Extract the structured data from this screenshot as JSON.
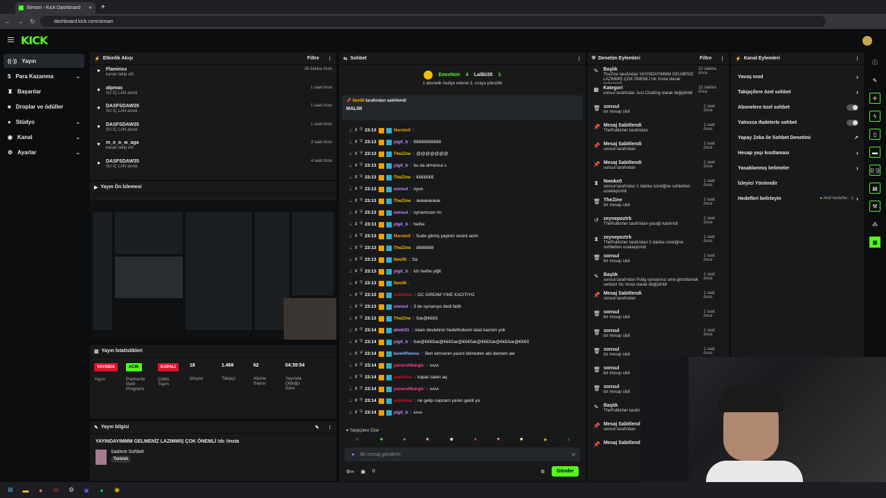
{
  "browser": {
    "tab_title": "Stream - Kick Dashboard",
    "url": "dashboard.kick.com/stream",
    "add_tab": "+",
    "close": "✕"
  },
  "app": {
    "logo": "KICK"
  },
  "sidebar": {
    "items": [
      {
        "label": "Yayın",
        "icon": "stream-icon",
        "active": true
      },
      {
        "label": "Para Kazanma",
        "icon": "money-icon",
        "chevron": true
      },
      {
        "label": "Başarılar",
        "icon": "trophy-icon"
      },
      {
        "label": "Droplar ve ödüller",
        "icon": "gift-icon"
      },
      {
        "label": "Stüdyo",
        "icon": "studio-icon",
        "chevron": true
      },
      {
        "label": "Kanal",
        "icon": "user-icon",
        "chevron": true
      },
      {
        "label": "Ayarlar",
        "icon": "gear-icon",
        "chevron": true
      }
    ]
  },
  "activity": {
    "title": "Etkinlik Akışı",
    "filter": "Filtre",
    "items": [
      {
        "name": "Flaminxx",
        "sub": "kanalı takip etti",
        "time": "38 dakika önce",
        "icon": "heart-icon"
      },
      {
        "name": "alpmas",
        "sub": "SU İÇ LAN alındı",
        "time": "1 saat önce",
        "icon": "reward-icon"
      },
      {
        "name": "DASFSDAW35",
        "sub": "SU İÇ LAN alındı",
        "time": "1 saat önce",
        "icon": "reward-icon"
      },
      {
        "name": "DASFSDAW35",
        "sub": "SU İÇ LAN alındı",
        "time": "1 saat önce",
        "icon": "reward-icon"
      },
      {
        "name": "m_e_o_w_aga",
        "sub": "kanalı takip etti",
        "time": "3 saat önce",
        "icon": "heart-icon"
      },
      {
        "name": "DASFSDAW35",
        "sub": "SU İÇ LAN alındı",
        "time": "4 saat önce",
        "icon": "reward-icon"
      }
    ]
  },
  "preview": {
    "title": "Yayın Ön İzlemesi"
  },
  "stats": {
    "title": "Yayın İstatistikleri",
    "items": [
      {
        "badge": "YAYINDA",
        "badge_color": "#e0112b",
        "label": "Yayın"
      },
      {
        "badge": "ACIK",
        "badge_color": "#53fc18",
        "label": "Partnerlik Gelir Programı"
      },
      {
        "badge": "KAPALI",
        "badge_color": "#e0112b",
        "label": "Çoklu Yayın"
      },
      {
        "value": "18",
        "label": "İzleyici"
      },
      {
        "value": "1.469",
        "label": "Takipçi"
      },
      {
        "value": "62",
        "label": "Abone Sayısı"
      },
      {
        "value": "04:39:54",
        "label": "Yayında Olduğu Süre"
      }
    ]
  },
  "info": {
    "title": "Yayın bilgisi",
    "stream_title": "YAYINDAYIMMM GELMENİZ LAZIMMIŞ ÇOK ÖNEMLİ !dc !insta",
    "category": "Sadece Sohbet",
    "language": "Turkish"
  },
  "chat": {
    "title": "Sohbet",
    "gift": {
      "user1": "EmreNoir",
      "count1": "4",
      "user2": "LalBii35",
      "count2": "1",
      "text": "1 abonelik hediye ederek 3. sıraya yükseltti"
    },
    "pinned": {
      "by": "Sevilli",
      "by_suffix": "tarafından sabitlendi",
      "text": "MALIM"
    },
    "messages": [
      {
        "time": "23:13",
        "user": "Nwoke0",
        "color": "#f0a000",
        "text": ""
      },
      {
        "time": "23:13",
        "user": "yigit_b",
        "color": "#c98bff",
        "text": "88888888888"
      },
      {
        "time": "23:13",
        "user": "TheZine",
        "color": "#f0c000",
        "text": "@@@@@@@"
      },
      {
        "time": "23:13",
        "user": "yigit_b",
        "color": "#c98bff",
        "text": "bu da almanca s"
      },
      {
        "time": "23:13",
        "user": "TheZine",
        "color": "#f0c000",
        "text": "€€€€€€€"
      },
      {
        "time": "23:13",
        "user": "sonsul",
        "color": "#c98bff",
        "text": "oyun"
      },
      {
        "time": "23:13",
        "user": "TheZine",
        "color": "#f0c000",
        "text": "ææææææ"
      },
      {
        "time": "23:13",
        "user": "sonsul",
        "color": "#c98bff",
        "text": "oynamıcan mı"
      },
      {
        "time": "23:13",
        "user": "yigit_b",
        "color": "#c98bff",
        "text": "heiße"
      },
      {
        "time": "23:13",
        "user": "Nwoke0",
        "color": "#f0a000",
        "text": "Sude gitmiş yayinin sesini acim"
      },
      {
        "time": "23:13",
        "user": "TheZine",
        "color": "#f0c000",
        "text": "8888888"
      },
      {
        "time": "23:13",
        "user": "Sevilli",
        "color": "#ffbb00",
        "text": "Sa"
      },
      {
        "time": "23:13",
        "user": "yigit_b",
        "color": "#c98bff",
        "text": "ich heiße yiğit"
      },
      {
        "time": "23:13",
        "user": "Sevilli",
        "color": "#ffbb00",
        "text": ""
      },
      {
        "time": "23:13",
        "user": "suterliss",
        "color": "#e0112b",
        "text": "DC GIRDIM YINE KAOTIYO"
      },
      {
        "time": "23:13",
        "user": "sonsul",
        "color": "#c98bff",
        "text": "3 de oynanıyo dedi fatih"
      },
      {
        "time": "23:13",
        "user": "TheZine",
        "color": "#f0c000",
        "text": "ßæ@€€€ß"
      },
      {
        "time": "23:14",
        "user": "ahoh31",
        "color": "#c98bff",
        "text": "islam devletinin hedefindesin talat kacisin yok"
      },
      {
        "time": "23:14",
        "user": "yigit_b",
        "color": "#c98bff",
        "text": "ßæ@€€€ßæ@€€€ßæ@€€€ßæ@€€€ßæ@€€€ßæ@€€€ß"
      },
      {
        "time": "23:14",
        "user": "leeelllfwwsc",
        "color": "#8ab4ff",
        "text": "Ben kimsenin yasini bilmeden abi demem aw"
      },
      {
        "time": "23:14",
        "user": "yaransitbargic",
        "color": "#ff4488",
        "text": "ʌʌʌʌ"
      },
      {
        "time": "23:14",
        "user": "suterliss",
        "color": "#e0112b",
        "text": "kapat zaten aq"
      },
      {
        "time": "23:14",
        "user": "yaransitbargic",
        "color": "#ff4488",
        "text": "ʌʌʌʌ"
      },
      {
        "time": "23:14",
        "user": "suterliss",
        "color": "#e0112b",
        "text": "ne gelip napcam yaren geldi ya"
      },
      {
        "time": "23:14",
        "user": "yigit_b",
        "color": "#c98bff",
        "text": "ʌʌʌʌ"
      }
    ],
    "followers_only": "Takipçilere Özel",
    "placeholder": "Bir mesaj gönderin",
    "points": "0",
    "send": "Gönder"
  },
  "moderation": {
    "title": "Denetim Eylemleri",
    "filter": "Filtre",
    "items": [
      {
        "name": "Başlık",
        "sub": "TheZine tarafından YAYINDAYIMMM GELMENİZ LAZIMMIŞ ÇOK ÖNEMLİ !dc !insta olarak değiştirildi",
        "time": "22 dakika önce",
        "icon": "edit-icon"
      },
      {
        "name": "Kategori",
        "sub": "sonsul tarafından Just Chatting olarak değiştirildi",
        "time": "22 dakika önce",
        "icon": "category-icon"
      },
      {
        "name": "sonsul",
        "sub": "bir mesajı sildi",
        "time": "1 saat önce",
        "icon": "trash-icon"
      },
      {
        "name": "Mesaj Sabitlendi",
        "sub": "ThePublisher tarafından",
        "time": "1 saat önce",
        "icon": "pin-icon"
      },
      {
        "name": "Mesaj Sabitlendi",
        "sub": "sonsul tarafından",
        "time": "1 saat önce",
        "icon": "pin-icon"
      },
      {
        "name": "Mesaj Sabitlendi",
        "sub": "sonsul tarafından",
        "time": "1 saat önce",
        "icon": "pin-icon"
      },
      {
        "name": "Nwoke0",
        "sub": "sonsul tarafından 1 dakika süreliğine sohbetten uzaklaştırıldı",
        "time": "1 saat önce",
        "icon": "timeout-icon"
      },
      {
        "name": "TheZine",
        "sub": "bir mesajı sildi",
        "time": "1 saat önce",
        "icon": "trash-icon"
      },
      {
        "name": "zeynepoztrk",
        "sub": "ThePublisher tarafından yasağı kaldırıldı",
        "time": "1 saat önce",
        "icon": "unban-icon"
      },
      {
        "name": "zeynepoztrk",
        "sub": "ThePublisher tarafından 5 dakika süreliğine sohbetten uzaklaştırıldı",
        "time": "1 saat önce",
        "icon": "timeout-icon"
      },
      {
        "name": "sonsul",
        "sub": "bir mesajı sildi",
        "time": "1 saat önce",
        "icon": "trash-icon"
      },
      {
        "name": "Başlık",
        "sub": "sonsul tarafından Pubg oynuyoruz ama ghostlamak serbest !dc !insta olarak değiştirildi",
        "time": "1 saat önce",
        "icon": "edit-icon"
      },
      {
        "name": "Mesaj Sabitlendi",
        "sub": "sonsul tarafından",
        "time": "1 saat önce",
        "icon": "pin-icon"
      },
      {
        "name": "sonsul",
        "sub": "bir mesajı sildi",
        "time": "1 saat önce",
        "icon": "trash-icon"
      },
      {
        "name": "sonsul",
        "sub": "bir mesajı sildi",
        "time": "1 saat önce",
        "icon": "trash-icon"
      },
      {
        "name": "sonsul",
        "sub": "bir mesajı sildi",
        "time": "1 saat önce",
        "icon": "trash-icon"
      },
      {
        "name": "sonsul",
        "sub": "bir mesajı sildi",
        "time": "1 saat önce",
        "icon": "trash-icon"
      },
      {
        "name": "sonsul",
        "sub": "bir mesajı sildi",
        "time": "1 saat önce",
        "icon": "trash-icon"
      },
      {
        "name": "Başlık",
        "sub": "ThePublisher tarafından ... izleyici !dc !insta",
        "time": "",
        "icon": "edit-icon"
      },
      {
        "name": "Mesaj Sabitlendi",
        "sub": "sonsul tarafından",
        "time": "",
        "icon": "pin-icon"
      },
      {
        "name": "Mesaj Sabitlendi",
        "sub": "",
        "time": "",
        "icon": "pin-icon"
      }
    ]
  },
  "channel": {
    "title": "Kanal Eylemleri",
    "items": [
      {
        "label": "Yavaş mod",
        "type": "chevron"
      },
      {
        "label": "Takipçilere özel sohbet",
        "type": "chevron"
      },
      {
        "label": "Abonelere özel sohbet",
        "type": "toggle"
      },
      {
        "label": "Yalnızca ifadelerle sohbet",
        "type": "toggle"
      },
      {
        "label": "Yapay Zeka ile Sohbet Denetimi",
        "type": "ext"
      },
      {
        "label": "Hesap yaşı kısıtlaması",
        "type": "chevron"
      },
      {
        "label": "Yasaklanmış kelimeler",
        "type": "chevron"
      },
      {
        "label": "İzleyici Yönlendir",
        "type": "none"
      },
      {
        "label": "Hedefleri belirleyin",
        "type": "goal",
        "extra": "Aktif hedefler - 2"
      }
    ]
  },
  "colors": {
    "brand": "#53fc18",
    "live": "#e0112b",
    "panel": "#18191b"
  }
}
